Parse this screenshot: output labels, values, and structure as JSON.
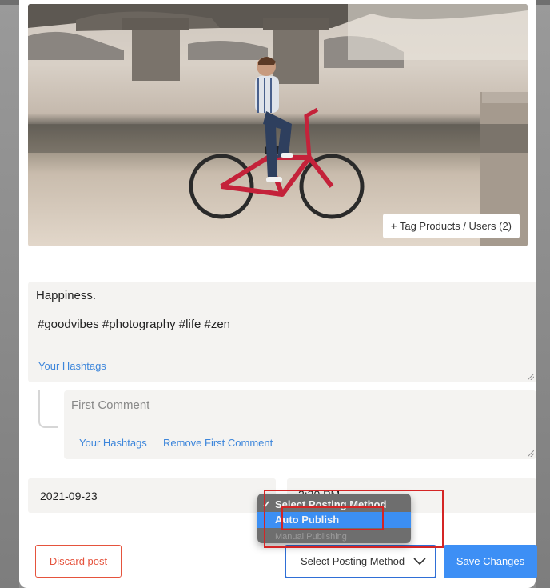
{
  "photo": {
    "tag_button_label": "+ Tag Products / Users (2)"
  },
  "caption": {
    "line1": "Happiness.",
    "line2": "#goodvibes #photography #life #zen",
    "hashtags_link": "Your Hashtags"
  },
  "first_comment": {
    "placeholder": "First Comment",
    "hashtags_link": "Your Hashtags",
    "remove_link": "Remove First Comment"
  },
  "schedule": {
    "date_value": "2021-09-23",
    "time_value": "2:30 PM"
  },
  "posting_method_dropdown": {
    "options": [
      {
        "label": "Select Posting Method",
        "checked": true
      },
      {
        "label": "Auto Publish",
        "highlighted": true
      },
      {
        "label": "Manual Publishing",
        "partially_visible": true
      }
    ],
    "check_mark": "✓"
  },
  "actions": {
    "discard_label": "Discard post",
    "method_select_label": "Select Posting Method",
    "save_label": "Save Changes"
  },
  "colors": {
    "accent_blue": "#3d8ff5",
    "link_blue": "#3d86db",
    "discard_red": "#e5533d",
    "highlight_red": "#d42525"
  }
}
